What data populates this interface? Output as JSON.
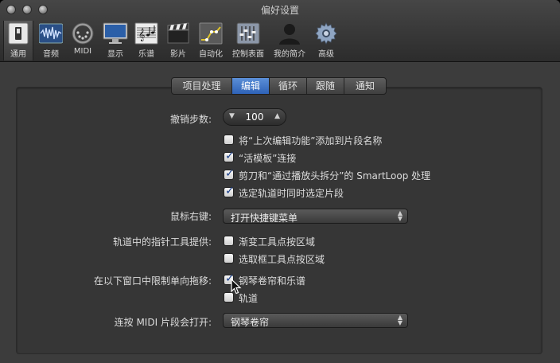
{
  "window": {
    "title": "偏好设置"
  },
  "toolbar": {
    "items": [
      {
        "label": "通用",
        "icon": "switch-icon",
        "selected": true
      },
      {
        "label": "音频",
        "icon": "waveform-icon"
      },
      {
        "label": "MIDI",
        "icon": "midi-connector-icon"
      },
      {
        "label": "显示",
        "icon": "monitor-icon"
      },
      {
        "label": "乐谱",
        "icon": "music-score-icon"
      },
      {
        "label": "影片",
        "icon": "film-clapper-icon"
      },
      {
        "label": "自动化",
        "icon": "automation-icon"
      },
      {
        "label": "控制表面",
        "icon": "control-surface-icon"
      },
      {
        "label": "我的简介",
        "icon": "user-silhouette-icon"
      },
      {
        "label": "高级",
        "icon": "gear-icon"
      }
    ]
  },
  "tabs": [
    {
      "label": "项目处理"
    },
    {
      "label": "编辑",
      "active": true
    },
    {
      "label": "循环"
    },
    {
      "label": "跟随"
    },
    {
      "label": "通知"
    }
  ],
  "settings": {
    "undo_label": "撤销步数:",
    "undo_value": "100",
    "opt1": "将“上次编辑功能”添加到片段名称",
    "opt2": "“活模板”连接",
    "opt3": "剪刀和“通过播放头拆分”的 SmartLoop 处理",
    "opt4": "选定轨道时同时选定片段",
    "right_click_label": "鼠标右键:",
    "right_click_value": "打开快捷键菜单",
    "pointer_label": "轨道中的指针工具提供:",
    "pointer_opt1": "渐变工具点按区域",
    "pointer_opt2": "选取框工具点按区域",
    "limit_label": "在以下窗口中限制单向拖移:",
    "limit_opt1": "钢琴卷帘和乐谱",
    "limit_opt2": "轨道",
    "dblclick_label": "连按 MIDI 片段会打开:",
    "dblclick_value": "钢琴卷帘"
  },
  "checked": {
    "opt1": false,
    "opt2": true,
    "opt3": true,
    "opt4": true,
    "pointer_opt1": false,
    "pointer_opt2": false,
    "limit_opt1": true,
    "limit_opt2": false
  },
  "colors": {
    "accent": "#3a6fc4",
    "window_bg": "#3c3c3c",
    "panel_bg": "#363636"
  }
}
